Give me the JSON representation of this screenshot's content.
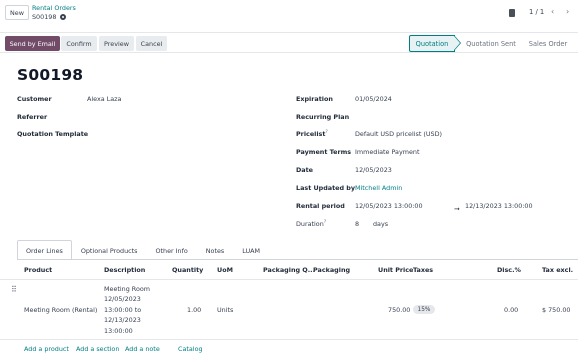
{
  "header": {
    "new_label": "New",
    "breadcrumb_parent": "Rental Orders",
    "record_name": "S00198",
    "pager": "1 / 1"
  },
  "buttons": {
    "send_email": "Send by Email",
    "confirm": "Confirm",
    "preview": "Preview",
    "cancel": "Cancel"
  },
  "status": [
    "Quotation",
    "Quotation Sent",
    "Sales Order"
  ],
  "status_active": "Quotation",
  "form": {
    "title": "S00198",
    "customer_label": "Customer",
    "customer": "Alexa Laza",
    "referrer_label": "Referrer",
    "quotation_template_label": "Quotation Template",
    "expiration_label": "Expiration",
    "expiration": "01/05/2024",
    "recurring_plan_label": "Recurring Plan",
    "pricelist_label": "Pricelist",
    "pricelist": "Default USD pricelist (USD)",
    "payment_terms_label": "Payment Terms",
    "payment_terms": "Immediate Payment",
    "date_label": "Date",
    "date": "12/05/2023",
    "last_updated_label": "Last Updated by",
    "last_updated": "Mitchell Admin",
    "rental_period_label": "Rental period",
    "rental_start": "12/05/2023 13:00:00",
    "rental_end": "12/13/2023 13:00:00",
    "duration_label": "Duration",
    "duration_value": "8",
    "duration_unit": "days"
  },
  "tabs": [
    "Order Lines",
    "Optional Products",
    "Other Info",
    "Notes",
    "LUAM"
  ],
  "table": {
    "columns": [
      "Product",
      "Description",
      "Quantity",
      "UoM",
      "Packaging Q...",
      "Packaging",
      "Unit Price",
      "Taxes",
      "Disc.%",
      "Tax excl."
    ],
    "row": {
      "product": "Meeting Room (Rental)",
      "description_lines": [
        "Meeting Room",
        "12/05/2023",
        "13:00:00 to",
        "12/13/2023",
        "13:00:00"
      ],
      "quantity": "1.00",
      "uom": "Units",
      "unit_price": "750.00",
      "tax_badge": "15%",
      "discount": "0.00",
      "subtotal": "$ 750.00"
    },
    "add_product": "Add a product",
    "add_section": "Add a section",
    "add_note": "Add a note",
    "catalog": "Catalog"
  },
  "colors": {
    "primary": "#714b67",
    "link": "#017e84"
  }
}
